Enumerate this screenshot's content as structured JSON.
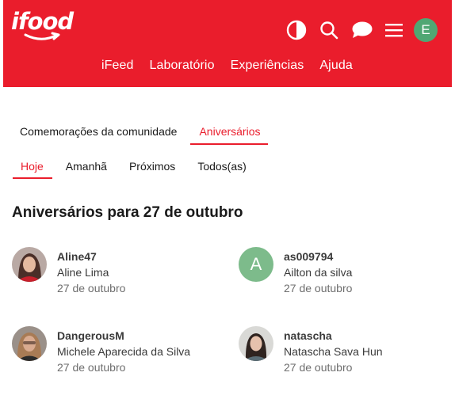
{
  "header": {
    "logo_text": "ifood",
    "user_initial": "E",
    "nav": [
      "iFeed",
      "Laboratório",
      "Experiências",
      "Ajuda"
    ]
  },
  "tabs_primary": [
    "Comemorações da comunidade",
    "Aniversários"
  ],
  "tabs_secondary": [
    "Hoje",
    "Amanhã",
    "Próximos",
    "Todos(as)"
  ],
  "main": {
    "title": "Aniversários para 27 de outubro"
  },
  "people": [
    {
      "username": "Aline47",
      "name": "Aline Lima",
      "date": "27 de outubro"
    },
    {
      "username": "as009794",
      "name": "Ailton da silva",
      "date": "27 de outubro",
      "initial": "A"
    },
    {
      "username": "DangerousM",
      "name": "Michele Aparecida da Silva",
      "date": "27 de outubro"
    },
    {
      "username": "natascha",
      "name": "Natascha Sava Hun",
      "date": "27 de outubro"
    }
  ],
  "colors": {
    "brand": "#ea1d2c",
    "avatar_user": "#50a773",
    "avatar_letter": "#7dbb8b"
  }
}
